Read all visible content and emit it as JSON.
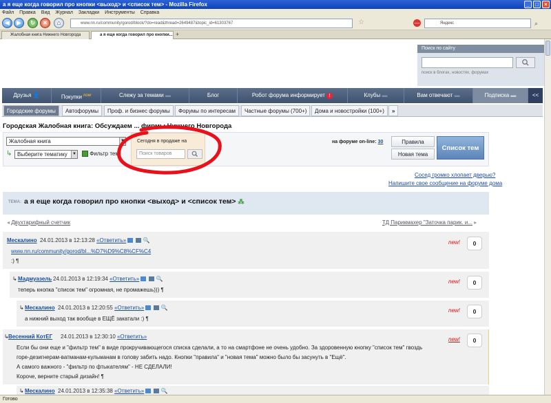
{
  "window": {
    "title": "а я еще когда говорил про кнопки <выход> и <список тем> - Mozilla Firefox",
    "controls": [
      "_",
      "□",
      "×"
    ]
  },
  "menu": [
    "Файл",
    "Правка",
    "Вид",
    "Журнал",
    "Закладки",
    "Инструменты",
    "Справка"
  ],
  "toolbar": {
    "url": "www.nn.ru/community/gorod/block/?do=read&thread=2649487&topic_id=61303767",
    "search_engine": "Яндекс"
  },
  "tabs": [
    {
      "label": "Жалобная книга Нижнего Новгорода",
      "active": false
    },
    {
      "label": "а я еще когда говорил про кнопки...",
      "active": true
    }
  ],
  "site_search": {
    "title": "Поиск по сайту",
    "hint": "поиск в блогах, новостях, форумах"
  },
  "main_nav": [
    {
      "label": "Друзья"
    },
    {
      "label": "Покупки",
      "sup": "now"
    },
    {
      "label": "Слежу за темами"
    },
    {
      "label": "Блог"
    },
    {
      "label": "Робот форума информирует"
    },
    {
      "label": "Клубы"
    },
    {
      "label": "Вам отвечают"
    },
    {
      "label": "Подписка"
    },
    {
      "label": "<<"
    }
  ],
  "sub_nav": [
    "Городские форумы",
    "Автофорумы",
    "Проф. и бизнес форумы",
    "Форумы по интересам",
    "Частные форумы (700+)",
    "Дома и новостройки (100+)",
    "»"
  ],
  "page_title": "Городская Жалобная книга: Обсуждаем ... фирмы Нижнего Новгорода",
  "controls": {
    "forum_select": "Жалобная книга",
    "topic_select": "Выберите тематику",
    "filter": "Фильтр тем",
    "promo_title": "Сегодня в продаже на",
    "promo_placeholder": "Поиск товаров",
    "online_label": "на форуме on-line:",
    "online_count": "30",
    "rules": "Правила",
    "new_topic": "Новая тема",
    "topic_list": "Список тем"
  },
  "side_links": [
    "Сосед громко хлопает дверью?",
    "Напишите свое сообщение на форуме дома"
  ],
  "topic": {
    "label": "ТЕМА:",
    "title": "а я еще когда говорил про кнопки <выход> и <список тем>",
    "prev": "Двухтарифный счетчик",
    "next": "ТД Парикмахер \"Заточка парик. и..."
  },
  "posts": [
    {
      "author": "Мескалино",
      "date": "24.01.2013 в 12:13:28",
      "reply": "«Ответить»",
      "lines": [
        "www.nn.ru/community/gorod/bl...%D7%D9%C8%CF%C4",
        ":) ¶"
      ],
      "new": "new!",
      "count": "0"
    },
    {
      "author": "Мадмуазель",
      "date": "24.01.2013 в 12:19:34",
      "reply": "«Ответить»",
      "lines": [
        "теперь кнопка \"список тем\" огромная, не промажешь))) ¶"
      ],
      "new": "new!",
      "count": "0"
    },
    {
      "author": "Мескалино",
      "date": "24.01.2013 в 12:20:55",
      "reply": "«Ответить»",
      "lines": [
        "а нижний выход так вообще в ЕЩЁ закатали :) ¶"
      ],
      "new": "new!",
      "count": "0"
    },
    {
      "author": "Весенний КотЕГ",
      "date": "24.01.2013 в 12:30:10",
      "reply": "«Ответить»",
      "lines": [
        "Если бы они еще и \"фильтр тем\" в виде прокручивающегося списка сделали, а то на смартфоне не очень удобно. За здоровенную кнопку \"список тем\" гвоздь",
        "горе-дезигнерам-ватманам-кульманам в голову забить надо. Кнопки \"правила\" и \"новая тема\" можно было бы засунуть в \"Ещё\".",
        "А самого важного - \"фильтр по фтыкателям\" - НЕ СДЕЛАЛИ!",
        "Короче, верните старый дизайн! ¶"
      ],
      "new": "new!",
      "count": "0"
    },
    {
      "author": "Мескалино",
      "date": "24.01.2013 в 12:35:38",
      "reply": "«Ответить»",
      "lines": [],
      "new": "",
      "count": ""
    }
  ],
  "status": {
    "text": "Готово"
  },
  "colors": {
    "annotation": "#e8101a",
    "new_badge": "#d61010",
    "link": "#1a4d9c"
  }
}
